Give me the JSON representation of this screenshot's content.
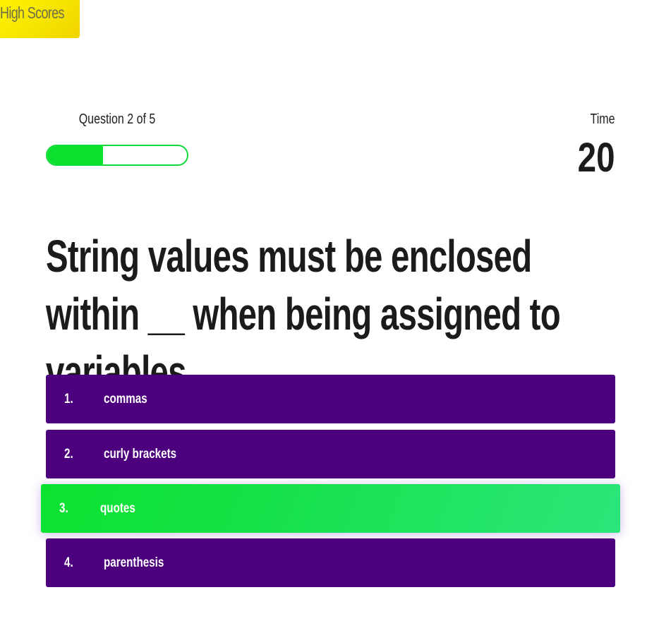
{
  "header": {
    "high_scores_label": "High Scores"
  },
  "hud": {
    "progress_text": "Question 2 of 5",
    "progress_fraction": 0.4,
    "time_label": "Time",
    "time_value": "20"
  },
  "question": {
    "text": "String values must be enclosed within __ when being assigned to variables."
  },
  "choices": [
    {
      "prefix": "1.",
      "text": "commas"
    },
    {
      "prefix": "2.",
      "text": "curly brackets"
    },
    {
      "prefix": "3.",
      "text": "quotes"
    },
    {
      "prefix": "4.",
      "text": "parenthesis"
    }
  ],
  "colors": {
    "accent_green": "#0be22f",
    "choice_purple": "#4d007d",
    "high_scores_yellow": "#fff200"
  }
}
